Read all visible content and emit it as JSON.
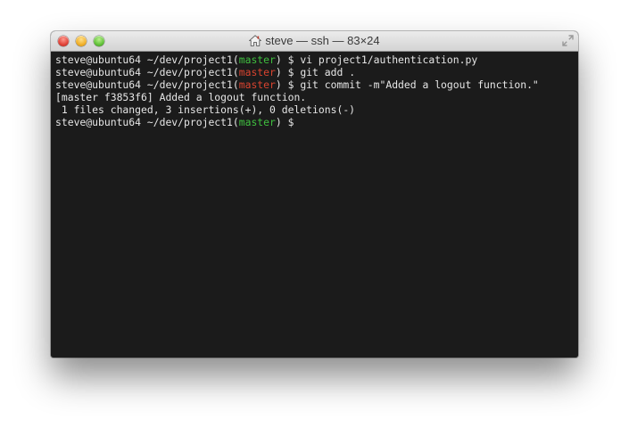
{
  "window": {
    "title": "steve — ssh — 83×24"
  },
  "colors": {
    "terminal_bg": "#1b1b1b",
    "text": "#e6e6e6",
    "branch_clean": "#3fbf3f",
    "branch_dirty": "#d8432f"
  },
  "terminal": {
    "lines": [
      {
        "prompt_pre": "steve@ubuntu64 ~/dev/project1(",
        "branch": "master",
        "prompt_post": ") $ ",
        "command": "vi project1/authentication.py"
      },
      {
        "prompt_pre": "steve@ubuntu64 ~/dev/project1(",
        "branch": "master",
        "prompt_post": ") $ ",
        "command": "git add ."
      },
      {
        "prompt_pre": "steve@ubuntu64 ~/dev/project1(",
        "branch": "master",
        "prompt_post": ") $ ",
        "command": "git commit -m\"Added a logout function.\""
      },
      {
        "output": "[master f3853f6] Added a logout function."
      },
      {
        "output": " 1 files changed, 3 insertions(+), 0 deletions(-)"
      },
      {
        "prompt_pre": "steve@ubuntu64 ~/dev/project1(",
        "branch": "master",
        "prompt_post": ") $ ",
        "command": ""
      }
    ]
  }
}
